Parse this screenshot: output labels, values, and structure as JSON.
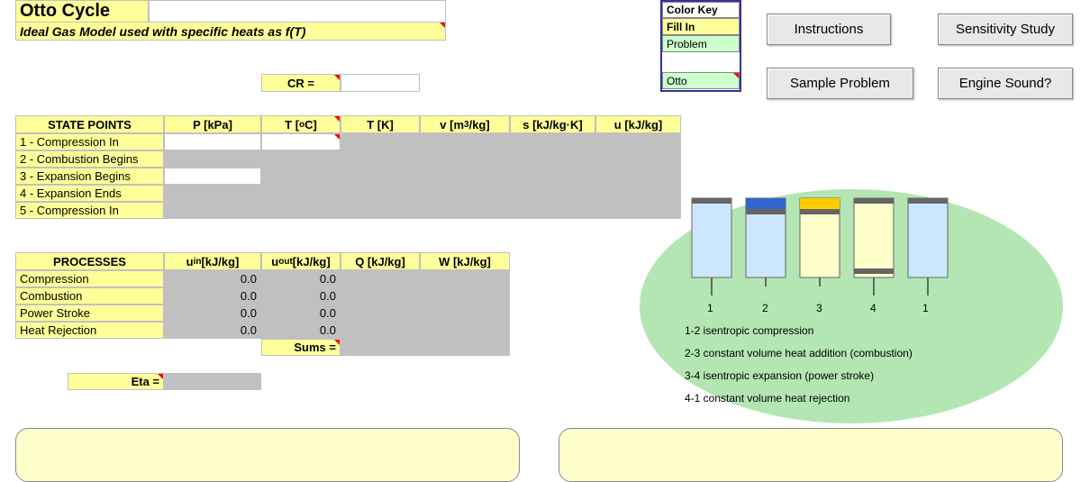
{
  "header": {
    "title": "Otto Cycle",
    "subtitle": "Ideal Gas Model used with specific heats as f(T)"
  },
  "cr_label": "CR =",
  "color_key": {
    "title": "Color Key",
    "rows": [
      "Fill In",
      "Problem",
      "Otto"
    ]
  },
  "buttons": {
    "instructions": "Instructions",
    "sensitivity": "Sensitivity Study",
    "sample": "Sample Problem",
    "sound": "Engine Sound?"
  },
  "state_table": {
    "title": "STATE POINTS",
    "headers": [
      "P [kPa]",
      "T [°C]",
      "T [K]",
      "v [m³/kg]",
      "s [kJ/kg·K]",
      "u [kJ/kg]"
    ],
    "rows": [
      "1 - Compression In",
      "2 - Combustion Begins",
      "3 - Expansion Begins",
      "4 - Expansion Ends",
      "5 - Compression In"
    ]
  },
  "process_table": {
    "title": "PROCESSES",
    "headers": [
      "uᵢₙ [kJ/kg]",
      "uₒᵤₜ [kJ/kg]",
      "Q [kJ/kg]",
      "W [kJ/kg]"
    ],
    "rows": [
      "Compression",
      "Combustion",
      "Power Stroke",
      "Heat Rejection"
    ],
    "uin": [
      "0.0",
      "0.0",
      "0.0",
      "0.0"
    ],
    "uout": [
      "0.0",
      "0.0",
      "0.0",
      "0.0"
    ],
    "sums_label": "Sums ="
  },
  "eta_label": "Eta =",
  "diagram": {
    "numbers": [
      "1",
      "2",
      "3",
      "4",
      "1"
    ],
    "lines": [
      "1-2 isentropic compression",
      "2-3 constant volume heat addition (combustion)",
      "3-4 isentropic expansion (power stroke)",
      "4-1 constant volume heat rejection"
    ]
  }
}
